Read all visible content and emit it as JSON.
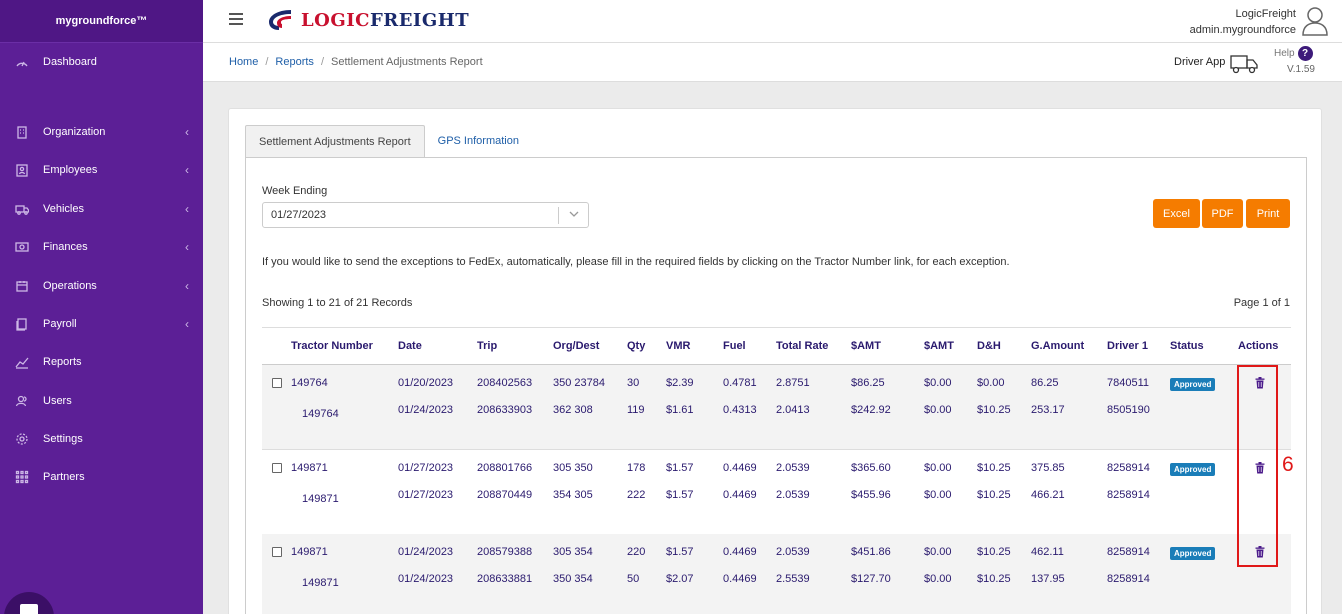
{
  "sidebar": {
    "brand": "mygroundforce™",
    "items": [
      {
        "label": "Dashboard",
        "icon": "dashboard-icon",
        "chevron": ""
      },
      {
        "label": "Organization",
        "icon": "building-icon",
        "chevron": "‹"
      },
      {
        "label": "Employees",
        "icon": "id-card-icon",
        "chevron": "‹"
      },
      {
        "label": "Vehicles",
        "icon": "truck-icon",
        "chevron": "‹"
      },
      {
        "label": "Finances",
        "icon": "money-icon",
        "chevron": "‹"
      },
      {
        "label": "Operations",
        "icon": "calendar-icon",
        "chevron": "‹"
      },
      {
        "label": "Payroll",
        "icon": "payroll-icon",
        "chevron": "‹"
      },
      {
        "label": "Reports",
        "icon": "chart-icon",
        "chevron": ""
      },
      {
        "label": "Users",
        "icon": "users-icon",
        "chevron": ""
      },
      {
        "label": "Settings",
        "icon": "gear-icon",
        "chevron": ""
      },
      {
        "label": "Partners",
        "icon": "grid-icon",
        "chevron": ""
      }
    ]
  },
  "header": {
    "logo_part1": "LOGIC",
    "logo_part2": "FREIGHT",
    "company": "LogicFreight",
    "user": "admin.mygroundforce",
    "driver_app": "Driver App",
    "help": "Help",
    "help_badge": "?",
    "version": "V.1.59"
  },
  "breadcrumb": {
    "home": "Home",
    "sep": "/",
    "reports": "Reports",
    "current": "Settlement Adjustments Report"
  },
  "tabs": {
    "active": "Settlement Adjustments Report",
    "inactive": "GPS Information"
  },
  "filters": {
    "week_ending_label": "Week Ending",
    "week_ending_value": "01/27/2023"
  },
  "buttons": {
    "excel": "Excel",
    "pdf": "PDF",
    "print": "Print"
  },
  "info_text": "If you would like to send the exceptions to FedEx, automatically, please fill in the required fields by clicking on the Tractor Number link, for each exception.",
  "showing": "Showing 1 to 21 of 21 Records",
  "page_info": "Page 1 of 1",
  "table": {
    "headers": [
      "Tractor Number",
      "Date",
      "Trip",
      "Org/Dest",
      "Qty",
      "VMR",
      "Fuel",
      "Total Rate",
      "$AMT",
      "$AMT",
      "D&H",
      "G.Amount",
      "Driver 1",
      "Status",
      "Actions"
    ],
    "groups": [
      {
        "tractor": "149764",
        "status": "Approved",
        "rows": [
          {
            "tractor": "149764",
            "date": "01/20/2023",
            "trip": "208402563",
            "org_dest": "350 23784",
            "qty": "30",
            "vmr": "$2.39",
            "fuel": "0.4781",
            "total_rate": "2.8751",
            "amt1": "$86.25",
            "amt2": "$0.00",
            "dh": "$0.00",
            "g_amount": "86.25",
            "driver1": "7840511"
          },
          {
            "tractor": "149764",
            "date": "01/24/2023",
            "trip": "208633903",
            "org_dest": "362 308",
            "qty": "119",
            "vmr": "$1.61",
            "fuel": "0.4313",
            "total_rate": "2.0413",
            "amt1": "$242.92",
            "amt2": "$0.00",
            "dh": "$10.25",
            "g_amount": "253.17",
            "driver1": "8505190"
          }
        ]
      },
      {
        "tractor": "149871",
        "status": "Approved",
        "rows": [
          {
            "tractor": "149871",
            "date": "01/27/2023",
            "trip": "208801766",
            "org_dest": "305 350",
            "qty": "178",
            "vmr": "$1.57",
            "fuel": "0.4469",
            "total_rate": "2.0539",
            "amt1": "$365.60",
            "amt2": "$0.00",
            "dh": "$10.25",
            "g_amount": "375.85",
            "driver1": "8258914"
          },
          {
            "tractor": "149871",
            "date": "01/27/2023",
            "trip": "208870449",
            "org_dest": "354 305",
            "qty": "222",
            "vmr": "$1.57",
            "fuel": "0.4469",
            "total_rate": "2.0539",
            "amt1": "$455.96",
            "amt2": "$0.00",
            "dh": "$10.25",
            "g_amount": "466.21",
            "driver1": "8258914"
          }
        ]
      },
      {
        "tractor": "149871",
        "status": "Approved",
        "rows": [
          {
            "tractor": "149871",
            "date": "01/24/2023",
            "trip": "208579388",
            "org_dest": "305 354",
            "qty": "220",
            "vmr": "$1.57",
            "fuel": "0.4469",
            "total_rate": "2.0539",
            "amt1": "$451.86",
            "amt2": "$0.00",
            "dh": "$10.25",
            "g_amount": "462.11",
            "driver1": "8258914"
          },
          {
            "tractor": "149871",
            "date": "01/24/2023",
            "trip": "208633881",
            "org_dest": "350 354",
            "qty": "50",
            "vmr": "$2.07",
            "fuel": "0.4469",
            "total_rate": "2.5539",
            "amt1": "$127.70",
            "amt2": "$0.00",
            "dh": "$10.25",
            "g_amount": "137.95",
            "driver1": "8258914"
          }
        ]
      }
    ]
  },
  "annotation": {
    "number": "6",
    "color": "#e01818"
  },
  "colors": {
    "sidebar": "#5c1f96",
    "accent_button": "#f57c00",
    "badge": "#1a7db8",
    "table_text": "#2a1a6e"
  }
}
